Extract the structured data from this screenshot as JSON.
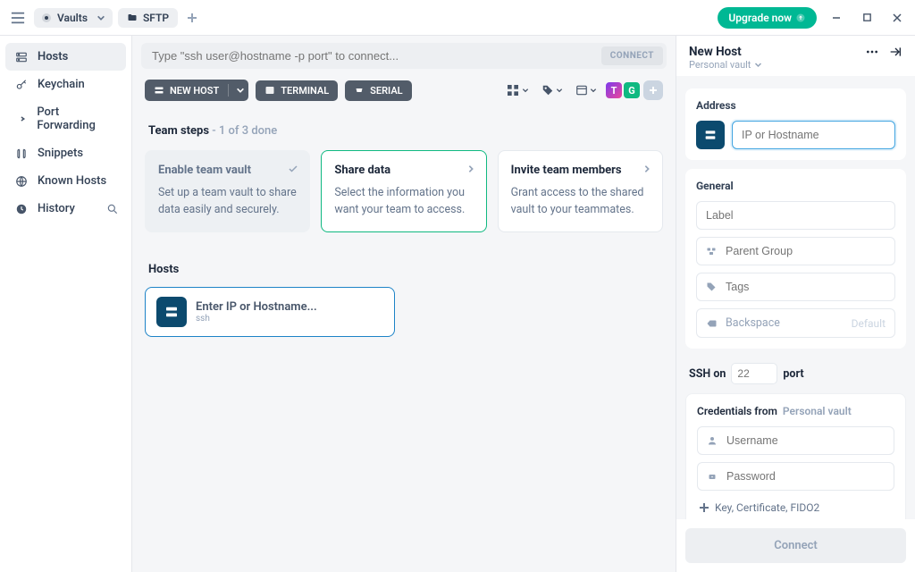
{
  "titlebar": {
    "vaults_label": "Vaults",
    "sftp_label": "SFTP",
    "upgrade_label": "Upgrade now"
  },
  "sidebar": {
    "items": [
      {
        "label": "Hosts"
      },
      {
        "label": "Keychain"
      },
      {
        "label": "Port Forwarding"
      },
      {
        "label": "Snippets"
      },
      {
        "label": "Known Hosts"
      },
      {
        "label": "History"
      }
    ]
  },
  "topbar": {
    "search_placeholder": "Type \"ssh user@hostname -p port\" to connect...",
    "connect_label": "CONNECT"
  },
  "toolbar": {
    "new_host": "NEW HOST",
    "terminal": "TERMINAL",
    "serial": "SERIAL",
    "avatar1": "T",
    "avatar2": "G"
  },
  "steps": {
    "title_strong": "Team steps",
    "title_rest": " - 1 of 3 done",
    "cards": [
      {
        "title": "Enable team vault",
        "body": "Set up a team vault to share data easily and securely."
      },
      {
        "title": "Share data",
        "body": "Select the information you want your team to access."
      },
      {
        "title": "Invite team members",
        "body": "Grant access to the shared vault to your teammates."
      }
    ]
  },
  "hosts": {
    "section_title": "Hosts",
    "placeholder": "Enter IP or Hostname...",
    "proto": "ssh"
  },
  "panel": {
    "title": "New Host",
    "subtitle": "Personal vault",
    "address_label": "Address",
    "address_placeholder": "IP or Hostname",
    "general_label": "General",
    "label_placeholder": "Label",
    "parent_placeholder": "Parent Group",
    "tags_placeholder": "Tags",
    "backspace_label": "Backspace",
    "backspace_value": "Default",
    "ssh_on": "SSH on",
    "port_value": "22",
    "port_label": "port",
    "cred_from": "Credentials from",
    "cred_vault": "Personal vault",
    "username_placeholder": "Username",
    "password_placeholder": "Password",
    "add_key_label": "Key, Certificate, FIDO2",
    "connect": "Connect"
  }
}
